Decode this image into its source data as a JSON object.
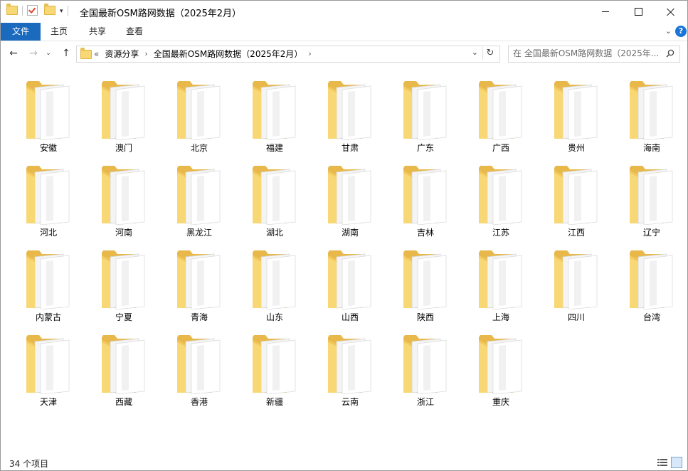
{
  "window": {
    "title": "全国最新OSM路网数据（2025年2月）",
    "qat_dropdown": "▾",
    "controls": {
      "minimize": "",
      "maximize": "",
      "close": ""
    }
  },
  "ribbon": {
    "tabs": [
      "文件",
      "主页",
      "共享",
      "查看"
    ],
    "expand": "⌄",
    "help": "?"
  },
  "nav": {
    "back": "←",
    "forward": "→",
    "recent": "⌄",
    "up": "↑"
  },
  "address": {
    "lead": "«",
    "crumbs": [
      "资源分享",
      "全国最新OSM路网数据（2025年2月）"
    ],
    "separator": "›",
    "dropdown": "⌄",
    "refresh": "↻"
  },
  "search": {
    "placeholder": "在 全国最新OSM路网数据（2025年..."
  },
  "folders": [
    "安徽",
    "澳门",
    "北京",
    "福建",
    "甘肃",
    "广东",
    "广西",
    "贵州",
    "海南",
    "河北",
    "河南",
    "黑龙江",
    "湖北",
    "湖南",
    "吉林",
    "江苏",
    "江西",
    "辽宁",
    "内蒙古",
    "宁夏",
    "青海",
    "山东",
    "山西",
    "陕西",
    "上海",
    "四川",
    "台湾",
    "天津",
    "西藏",
    "香港",
    "新疆",
    "云南",
    "浙江",
    "重庆"
  ],
  "status": {
    "item_count": "34 个项目"
  },
  "colors": {
    "accent": "#1a6bbd",
    "folder_front": "#f8d775",
    "folder_back": "#e8b94a"
  }
}
